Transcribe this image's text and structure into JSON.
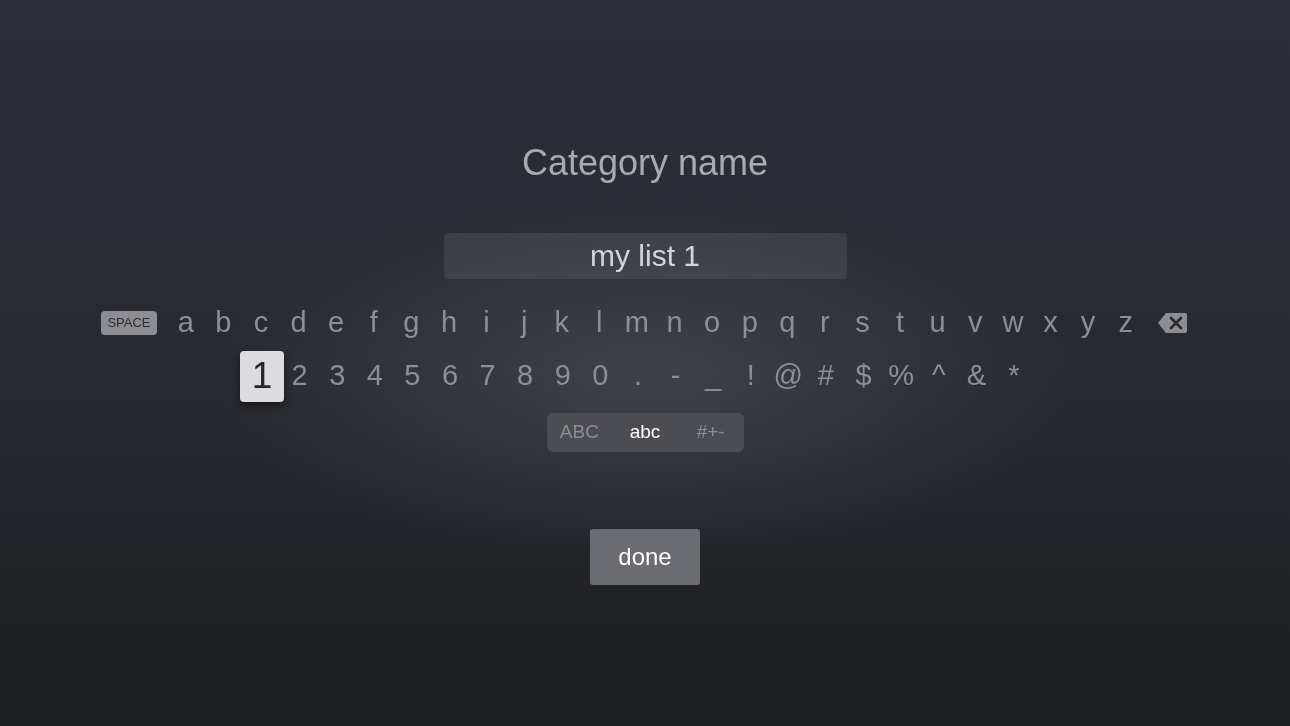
{
  "title": "Category name",
  "text_field": {
    "value": "my list 1"
  },
  "keyboard": {
    "rows": [
      {
        "keys": [
          {
            "kind": "space",
            "label": "SPACE",
            "selected": false
          },
          {
            "kind": "char",
            "label": "a",
            "selected": false
          },
          {
            "kind": "char",
            "label": "b",
            "selected": false
          },
          {
            "kind": "char",
            "label": "c",
            "selected": false
          },
          {
            "kind": "char",
            "label": "d",
            "selected": false
          },
          {
            "kind": "char",
            "label": "e",
            "selected": false
          },
          {
            "kind": "char",
            "label": "f",
            "selected": false
          },
          {
            "kind": "char",
            "label": "g",
            "selected": false
          },
          {
            "kind": "char",
            "label": "h",
            "selected": false
          },
          {
            "kind": "char",
            "label": "i",
            "selected": false
          },
          {
            "kind": "char",
            "label": "j",
            "selected": false
          },
          {
            "kind": "char",
            "label": "k",
            "selected": false
          },
          {
            "kind": "char",
            "label": "l",
            "selected": false
          },
          {
            "kind": "char",
            "label": "m",
            "selected": false
          },
          {
            "kind": "char",
            "label": "n",
            "selected": false
          },
          {
            "kind": "char",
            "label": "o",
            "selected": false
          },
          {
            "kind": "char",
            "label": "p",
            "selected": false
          },
          {
            "kind": "char",
            "label": "q",
            "selected": false
          },
          {
            "kind": "char",
            "label": "r",
            "selected": false
          },
          {
            "kind": "char",
            "label": "s",
            "selected": false
          },
          {
            "kind": "char",
            "label": "t",
            "selected": false
          },
          {
            "kind": "char",
            "label": "u",
            "selected": false
          },
          {
            "kind": "char",
            "label": "v",
            "selected": false
          },
          {
            "kind": "char",
            "label": "w",
            "selected": false
          },
          {
            "kind": "char",
            "label": "x",
            "selected": false
          },
          {
            "kind": "char",
            "label": "y",
            "selected": false
          },
          {
            "kind": "char",
            "label": "z",
            "selected": false
          },
          {
            "kind": "delete",
            "selected": false
          }
        ]
      },
      {
        "keys": [
          {
            "kind": "char",
            "label": "1",
            "selected": true
          },
          {
            "kind": "char",
            "label": "2",
            "selected": false
          },
          {
            "kind": "char",
            "label": "3",
            "selected": false
          },
          {
            "kind": "char",
            "label": "4",
            "selected": false
          },
          {
            "kind": "char",
            "label": "5",
            "selected": false
          },
          {
            "kind": "char",
            "label": "6",
            "selected": false
          },
          {
            "kind": "char",
            "label": "7",
            "selected": false
          },
          {
            "kind": "char",
            "label": "8",
            "selected": false
          },
          {
            "kind": "char",
            "label": "9",
            "selected": false
          },
          {
            "kind": "char",
            "label": "0",
            "selected": false
          },
          {
            "kind": "char",
            "label": ".",
            "selected": false
          },
          {
            "kind": "char",
            "label": "-",
            "selected": false
          },
          {
            "kind": "char",
            "label": "_",
            "selected": false
          },
          {
            "kind": "char",
            "label": "!",
            "selected": false
          },
          {
            "kind": "char",
            "label": "@",
            "selected": false
          },
          {
            "kind": "char",
            "label": "#",
            "selected": false
          },
          {
            "kind": "char",
            "label": "$",
            "selected": false
          },
          {
            "kind": "char",
            "label": "%",
            "selected": false
          },
          {
            "kind": "char",
            "label": "^",
            "selected": false
          },
          {
            "kind": "char",
            "label": "&",
            "selected": false
          },
          {
            "kind": "char",
            "label": "*",
            "selected": false
          }
        ]
      }
    ],
    "modes": [
      {
        "label": "ABC",
        "selected": false
      },
      {
        "label": "abc",
        "selected": true
      },
      {
        "label": "#+-",
        "selected": false
      }
    ]
  },
  "done_button": {
    "label": "done"
  }
}
